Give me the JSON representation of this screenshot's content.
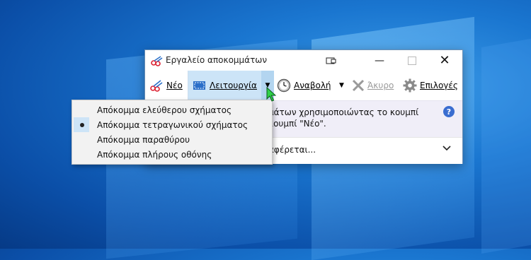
{
  "window": {
    "title": "Εργαλείο αποκομμάτων"
  },
  "toolbar": {
    "new_label": "Νέο",
    "mode_label": "Λειτουργία",
    "delay_label": "Αναβολή",
    "cancel_label": "Άκυρο",
    "options_label": "Επιλογές"
  },
  "info": {
    "text": "μάτων χρησιμοποιώντας το κουμπί\nκουμπί \"Νέο\".",
    "help_symbol": "?"
  },
  "expand": {
    "text": "αφέρεται...",
    "chevron": "⌵"
  },
  "mode_menu": {
    "items": [
      {
        "label": "Απόκομμα ελεύθερου σχήματος",
        "selected": false
      },
      {
        "label": "Απόκομμα τετραγωνικού σχήματος",
        "selected": true
      },
      {
        "label": "Απόκομμα παραθύρου",
        "selected": false
      },
      {
        "label": "Απόκομμα πλήρους οθόνης",
        "selected": false
      }
    ]
  },
  "icons": {
    "app": "scissors-icon",
    "new": "scissors-icon",
    "mode": "rectangle-snip-icon",
    "delay": "clock-icon",
    "cancel": "x-icon",
    "options": "gear-icon",
    "help": "help-icon"
  },
  "colors": {
    "accent": "#0078d7",
    "mode_highlight": "#cce4f7",
    "info_bg": "#f0eef8",
    "desktop": "#1a76d0"
  }
}
